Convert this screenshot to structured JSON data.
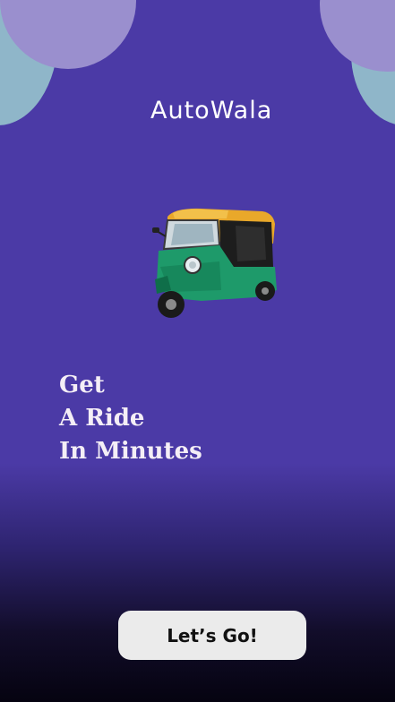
{
  "app": {
    "brand": "AutoWala"
  },
  "hero": {
    "image_icon": "auto-rickshaw-illustration",
    "tagline": [
      "Get",
      "A Ride",
      "In Minutes"
    ]
  },
  "cta": {
    "label": "Let’s Go!"
  },
  "colors": {
    "background": "#4b3aa6",
    "background_bottom": "#050310",
    "blob_lilac": "#9a8fce",
    "blob_teal": "#8fb6c9",
    "button_bg": "#ebebeb"
  }
}
